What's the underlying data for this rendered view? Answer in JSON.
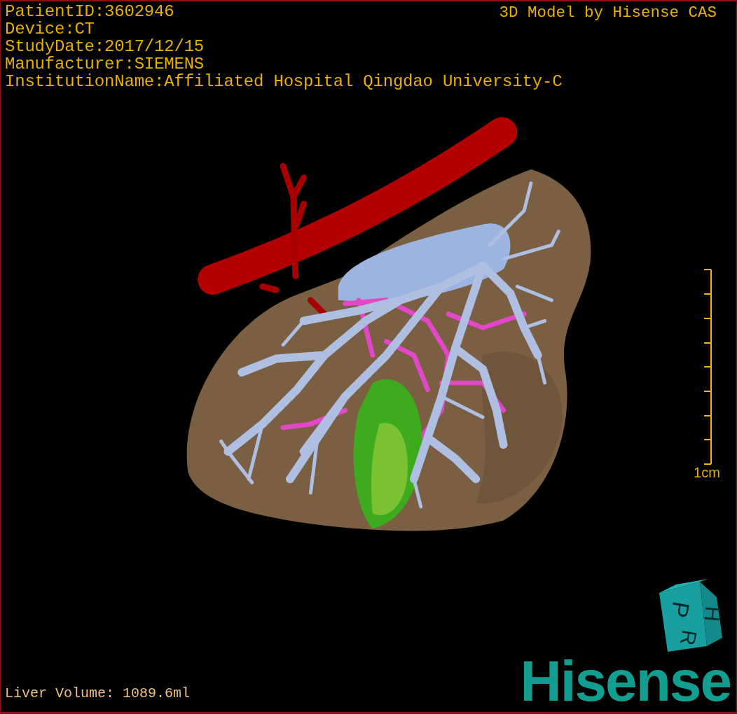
{
  "study_info": [
    "PatientID:3602946",
    "Device:CT",
    "StudyDate:2017/12/15",
    "Manufacturer:SIEMENS",
    "InstitutionName:Affiliated Hospital Qingdao University-C"
  ],
  "credit": "3D Model by Hisense CAS",
  "scale": {
    "label": "1cm"
  },
  "liver_volume": "Liver Volume: 1089.6ml",
  "orientation_cube": {
    "faces": [
      "P",
      "R",
      "H"
    ]
  },
  "logo": "Hisense"
}
